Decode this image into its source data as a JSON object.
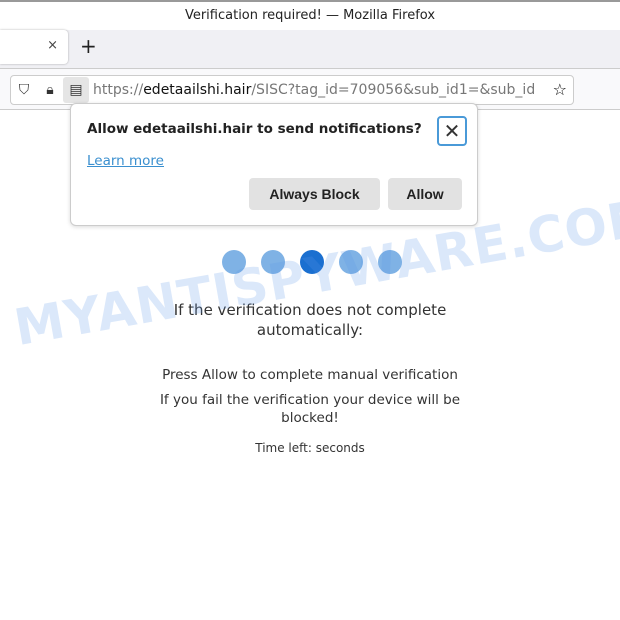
{
  "window": {
    "title": "Verification required! — Mozilla Firefox"
  },
  "tabs": {
    "close": "×",
    "new_tab": "+"
  },
  "urlbar": {
    "scheme": "https://",
    "domain": "edetaailshi.hair",
    "path": "/SISC?tag_id=709056&sub_id1=&sub_id"
  },
  "popup": {
    "title": "Allow edetaailshi.hair to send notifications?",
    "learn_more": "Learn more",
    "always_block": "Always Block",
    "allow": "Allow",
    "close": "✕"
  },
  "page": {
    "dots": 5,
    "active_dot": 3,
    "line1": "If the verification does not complete automatically:",
    "line2": "Press Allow to complete manual verification",
    "line3": "If you fail the verification your device will be blocked!",
    "line4": "Time left: seconds"
  },
  "watermark": "MYANTISPYWARE.COM",
  "colors": {
    "dot": "#7fb2e5",
    "dot_active": "#1a6fd0",
    "link": "#3a8fcf"
  }
}
